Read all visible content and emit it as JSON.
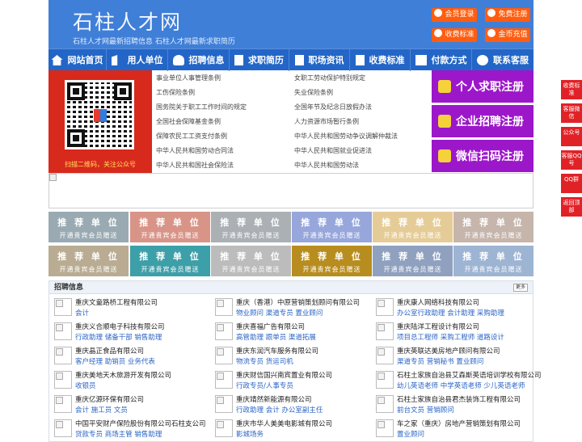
{
  "site": {
    "logo": "石柱人才网",
    "slogan": "石柱人才网最新招聘信息    石柱人才网最新求职简历"
  },
  "header_buttons": [
    {
      "label": "会员登录",
      "icon": "user-icon"
    },
    {
      "label": "免费注册",
      "icon": "register-icon"
    },
    {
      "label": "收费标准",
      "icon": "yen-icon"
    },
    {
      "label": "金币充值",
      "icon": "coin-icon"
    }
  ],
  "nav": [
    {
      "label": "网站首页",
      "icon": "home-icon"
    },
    {
      "label": "用人单位",
      "icon": "building-icon"
    },
    {
      "label": "招聘信息",
      "icon": "person-icon"
    },
    {
      "label": "求职简历",
      "icon": "pencil-icon"
    },
    {
      "label": "职场资讯",
      "icon": "document-icon"
    },
    {
      "label": "收费标准",
      "icon": "document-icon"
    },
    {
      "label": "付款方式",
      "icon": "card-icon"
    },
    {
      "label": "联系客服",
      "icon": "phone-icon"
    }
  ],
  "qr_caption": "扫描二维码，关注公众号",
  "laws_left": [
    "事业单位人事管理条例",
    "工伤保险条例",
    "国务院关于职工工作时间的规定",
    "全国社会保障基金条例",
    "保障农民工工资支付条例",
    "中华人民共和国劳动合同法",
    "中华人民共和国社会保险法"
  ],
  "laws_right": [
    "女职工劳动保护特别规定",
    "失业保险条例",
    "全国年节及纪念日放假办法",
    "人力资源市场暂行条例",
    "中华人民共和国劳动争议调解仲裁法",
    "中华人民共和国就业促进法",
    "中华人民共和国劳动法"
  ],
  "register_buttons": [
    "个人求职注册",
    "企业招聘注册",
    "微信扫码注册"
  ],
  "recommend": {
    "title": "推 荐 单 位",
    "sub": "开通贵宾会员赠送",
    "colors": [
      "#9aaab3",
      "#d99488",
      "#aab0b4",
      "#97a7dc",
      "#e5cc97",
      "#c5b5ab",
      "#b9ac92",
      "#3d9fa8",
      "#bcbcbc",
      "#b88d1f",
      "#8fa1bf",
      "#9db4d3"
    ]
  },
  "section": {
    "title": "招聘信息",
    "more": "更多"
  },
  "jobs": [
    [
      {
        "company": "重庆文童路桥工程有限公司",
        "positions": "会计"
      },
      {
        "company": "重庆义合顺电子科技有限公司",
        "positions": "行政助理 储备干部 销售助理"
      },
      {
        "company": "重庆晶正食品有限公司",
        "positions": "客户经理 助销员 业务代表"
      },
      {
        "company": "重庆美地天木旅游开发有限公司",
        "positions": "收银员"
      },
      {
        "company": "重庆亿源环保有限公司",
        "positions": "会计 施工员 文员"
      },
      {
        "company": "中国平安财产保险股份有限公司石柱支公司",
        "positions": "贷款专员 商场主管 销售助理"
      }
    ],
    [
      {
        "company": "重庆（香港）中原营销策划顾问有限公司",
        "positions": "物业顾问 渠道专员 置业顾问"
      },
      {
        "company": "重庆喜福广告有限公司",
        "positions": "高管助理 跟单员 渠道拓展"
      },
      {
        "company": "重庆东润汽车服务有限公司",
        "positions": "物流专员 货运司机"
      },
      {
        "company": "重庆财信国兴南宾置业有限公司",
        "positions": "行政专员/人事专员"
      },
      {
        "company": "重庆靖然新能源有限公司",
        "positions": "行政助理 会计 办公室副主任"
      },
      {
        "company": "重庆市华人美美电影城有限公司",
        "positions": "影城场务"
      }
    ],
    [
      {
        "company": "重庆康人网络科技有限公司",
        "positions": "办公室行政助理 会计助理 采购助理"
      },
      {
        "company": "重庆陆洋工程设计有限公司",
        "positions": "项目总工程师 采购工程师 道路设计"
      },
      {
        "company": "重庆英联达美房地产顾问有限公司",
        "positions": "渠道专员 营销秘书 置业顾问"
      },
      {
        "company": "石柱土家族自治县艾森斯英语培训学校有限公司",
        "positions": "幼儿英语老师 中学英语老师 少儿英语老师"
      },
      {
        "company": "石柱土家族自治县君杰装饰工程有限公司",
        "positions": "前台文员 营销顾问"
      },
      {
        "company": "车之家（重庆）房地产营销策划有限公司",
        "positions": "置业顾问"
      }
    ]
  ],
  "side_buttons": [
    "收费标准",
    "客服微信",
    "公众号",
    "客服QQ号",
    "QQ群",
    "返回顶部"
  ]
}
